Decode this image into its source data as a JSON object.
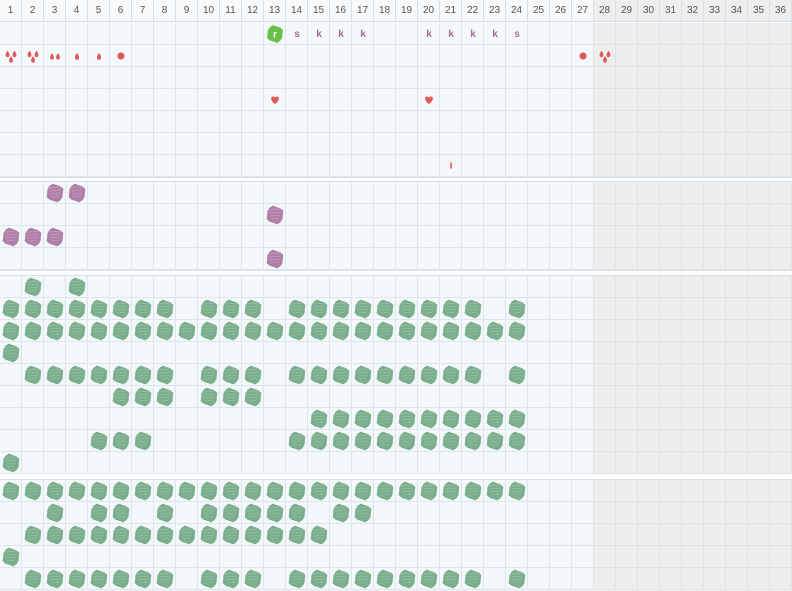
{
  "columns": [
    "1",
    "2",
    "3",
    "4",
    "5",
    "6",
    "7",
    "8",
    "9",
    "10",
    "11",
    "12",
    "13",
    "14",
    "15",
    "16",
    "17",
    "18",
    "19",
    "20",
    "21",
    "22",
    "23",
    "24",
    "25",
    "26",
    "27",
    "28",
    "29",
    "30",
    "31",
    "32",
    "33",
    "34",
    "35",
    "36"
  ],
  "disabled_from_column": "28",
  "colors": {
    "grid_line": "#dae6eb",
    "cell": "#f4f8fa",
    "disabled_cell": "#eeeeee",
    "drop": "#e05a5a",
    "purple": "#b07fa8",
    "green": "#7aae8c",
    "bright_green": "#6abf4b",
    "letter": "#a56a9c"
  },
  "sections": [
    {
      "rows": 7,
      "items": [
        {
          "row": 0,
          "col": 13,
          "kind": "green-badge",
          "label": "r"
        },
        {
          "row": 0,
          "col": 14,
          "kind": "letter",
          "label": "s"
        },
        {
          "row": 0,
          "col": 15,
          "kind": "letter",
          "label": "k"
        },
        {
          "row": 0,
          "col": 16,
          "kind": "letter",
          "label": "k"
        },
        {
          "row": 0,
          "col": 17,
          "kind": "letter",
          "label": "k"
        },
        {
          "row": 0,
          "col": 20,
          "kind": "letter",
          "label": "k"
        },
        {
          "row": 0,
          "col": 21,
          "kind": "letter",
          "label": "k"
        },
        {
          "row": 0,
          "col": 22,
          "kind": "letter",
          "label": "k"
        },
        {
          "row": 0,
          "col": 23,
          "kind": "letter",
          "label": "k"
        },
        {
          "row": 0,
          "col": 24,
          "kind": "letter",
          "label": "s"
        },
        {
          "row": 1,
          "col": 1,
          "kind": "drops3"
        },
        {
          "row": 1,
          "col": 2,
          "kind": "drops3"
        },
        {
          "row": 1,
          "col": 3,
          "kind": "drops2"
        },
        {
          "row": 1,
          "col": 4,
          "kind": "drop1"
        },
        {
          "row": 1,
          "col": 5,
          "kind": "drop1"
        },
        {
          "row": 1,
          "col": 6,
          "kind": "dot"
        },
        {
          "row": 1,
          "col": 27,
          "kind": "dot"
        },
        {
          "row": 1,
          "col": 28,
          "kind": "drops3"
        },
        {
          "row": 3,
          "col": 13,
          "kind": "heart"
        },
        {
          "row": 3,
          "col": 20,
          "kind": "heart"
        },
        {
          "row": 6,
          "col": 21,
          "kind": "tick"
        }
      ]
    },
    {
      "rows": 4,
      "items": [
        {
          "row": 0,
          "col": 3,
          "kind": "purple"
        },
        {
          "row": 0,
          "col": 4,
          "kind": "purple"
        },
        {
          "row": 1,
          "col": 13,
          "kind": "purple"
        },
        {
          "row": 2,
          "col": 1,
          "kind": "purple"
        },
        {
          "row": 2,
          "col": 2,
          "kind": "purple"
        },
        {
          "row": 2,
          "col": 3,
          "kind": "purple"
        },
        {
          "row": 3,
          "col": 13,
          "kind": "purple"
        }
      ]
    },
    {
      "rows": 9,
      "green_rows": [
        [
          2,
          4
        ],
        [
          1,
          2,
          3,
          4,
          5,
          6,
          7,
          8,
          10,
          11,
          12,
          14,
          15,
          16,
          17,
          18,
          19,
          20,
          21,
          22,
          24
        ],
        [
          1,
          2,
          3,
          4,
          5,
          6,
          7,
          8,
          9,
          10,
          11,
          12,
          13,
          14,
          15,
          16,
          17,
          18,
          19,
          20,
          21,
          22,
          23,
          24
        ],
        [
          1
        ],
        [
          2,
          3,
          4,
          5,
          6,
          7,
          8,
          10,
          11,
          12,
          14,
          15,
          16,
          17,
          18,
          19,
          20,
          21,
          22,
          24
        ],
        [
          6,
          7,
          8,
          10,
          11,
          12
        ],
        [
          15,
          16,
          17,
          18,
          19,
          20,
          21,
          22,
          23,
          24
        ],
        [
          5,
          6,
          7,
          14,
          15,
          16,
          17,
          18,
          19,
          20,
          21,
          22,
          23,
          24
        ],
        [
          1
        ]
      ]
    },
    {
      "rows": 5,
      "green_rows": [
        [
          1,
          2,
          3,
          4,
          5,
          6,
          7,
          8,
          9,
          10,
          11,
          12,
          13,
          14,
          15,
          16,
          17,
          18,
          19,
          20,
          21,
          22,
          23,
          24
        ],
        [
          3,
          5,
          6,
          8,
          10,
          11,
          12,
          13,
          14,
          16,
          17
        ],
        [
          2,
          3,
          4,
          5,
          6,
          7,
          8,
          9,
          10,
          11,
          12,
          13,
          14,
          15
        ],
        [
          1
        ],
        [
          2,
          3,
          4,
          5,
          6,
          7,
          8,
          10,
          11,
          12,
          14,
          15,
          16,
          17,
          18,
          19,
          20,
          21,
          22,
          24
        ]
      ]
    }
  ]
}
